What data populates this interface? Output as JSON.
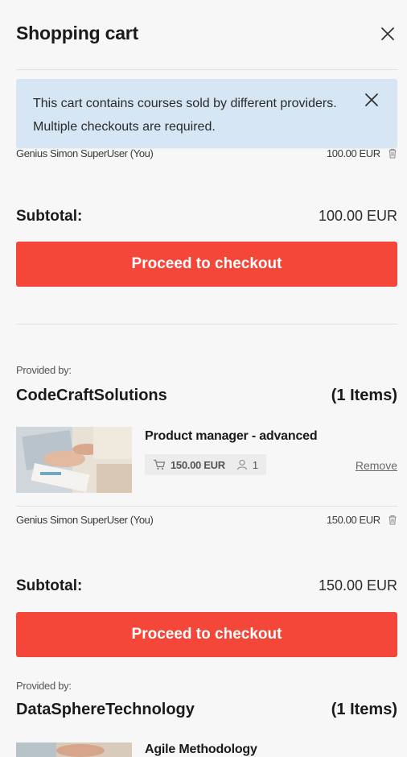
{
  "header": {
    "title": "Shopping cart"
  },
  "notice": {
    "text": "This cart contains courses sold by different providers. Multiple checkouts are required."
  },
  "first_group": {
    "participant": "Genius Simon SuperUser (You)",
    "participant_price": "100.00 EUR",
    "subtotal_label": "Subtotal:",
    "subtotal_value": "100.00 EUR",
    "checkout_label": "Proceed to checkout"
  },
  "second_group": {
    "provided_by_label": "Provided by:",
    "provider_name": "CodeCraftSolutions",
    "item_count": "(1 Items)",
    "course": {
      "title": "Product manager - advanced",
      "price": "150.00 EUR",
      "seats": "1",
      "remove_label": "Remove"
    },
    "participant": "Genius Simon SuperUser (You)",
    "participant_price": "150.00 EUR",
    "subtotal_label": "Subtotal:",
    "subtotal_value": "150.00 EUR",
    "checkout_label": "Proceed to checkout"
  },
  "third_group": {
    "provided_by_label": "Provided by:",
    "provider_name": "DataSphereTechnology",
    "item_count": "(1 Items)",
    "course": {
      "title": "Agile Methodology"
    }
  },
  "colors": {
    "accent": "#f4473a",
    "notice_bg": "#d6e6f4",
    "panel_bg": "#f7f7f7"
  },
  "icons": [
    "close-icon",
    "trash-icon",
    "cart-icon",
    "user-icon"
  ]
}
